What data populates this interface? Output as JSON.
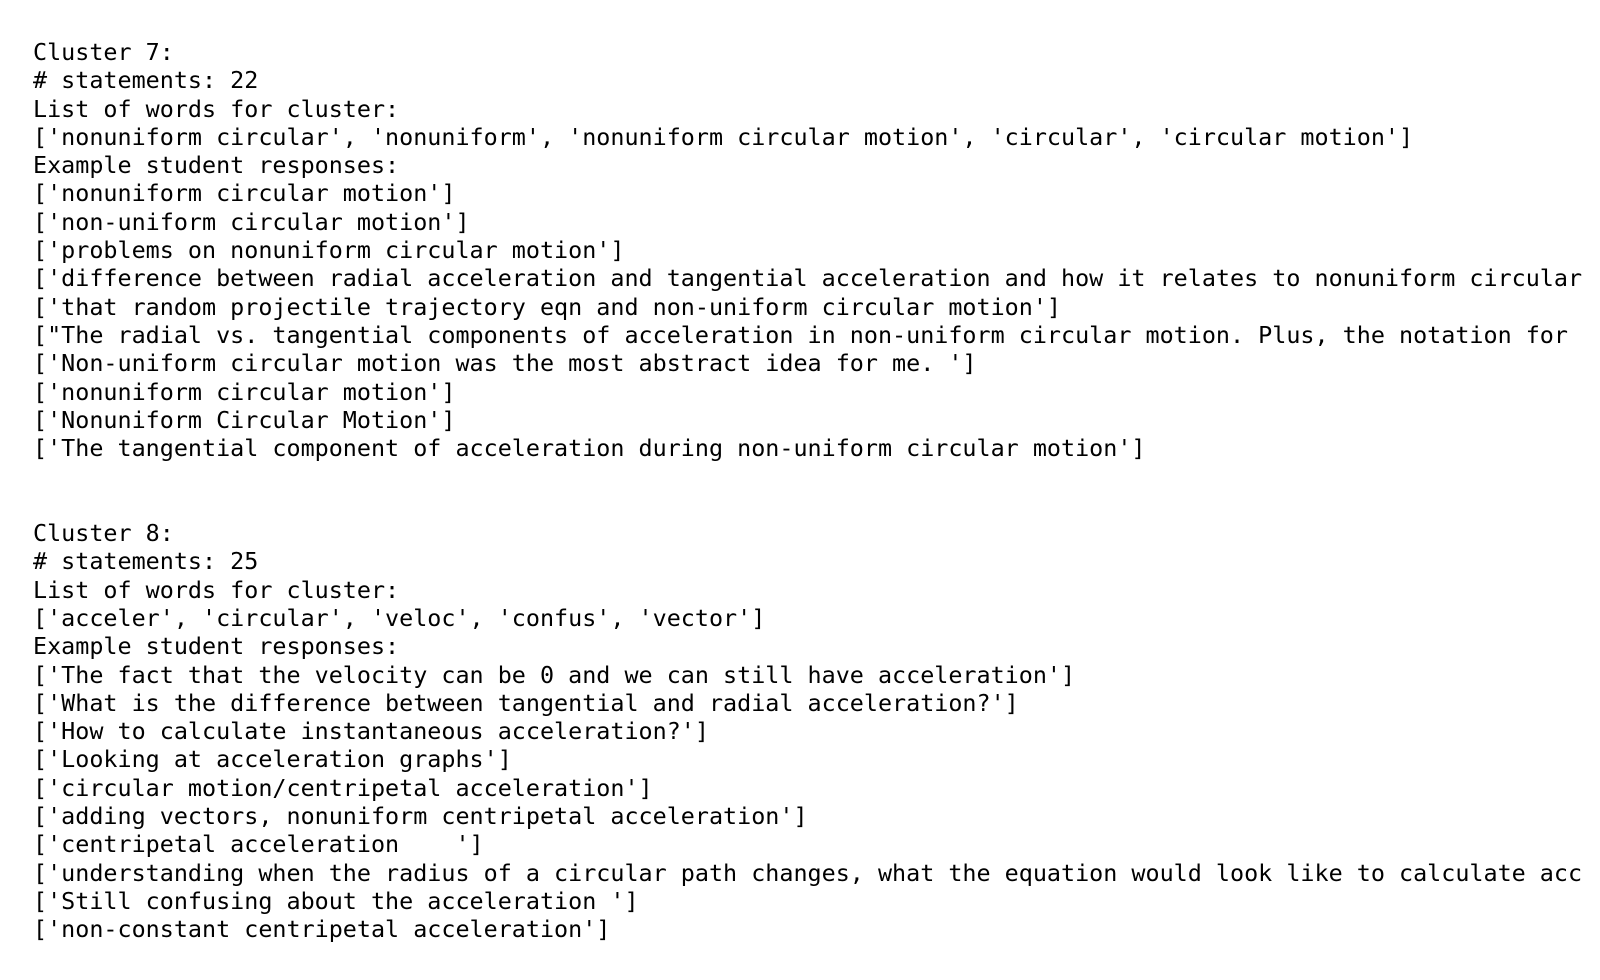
{
  "clusters": [
    {
      "header": "Cluster 7:",
      "statements": "# statements: 22",
      "words_label": "List of words for cluster:",
      "words": "['nonuniform circular', 'nonuniform', 'nonuniform circular motion', 'circular', 'circular motion']",
      "examples_label": "Example student responses:",
      "examples": [
        "['nonuniform circular motion']",
        "['non-uniform circular motion']",
        "['problems on nonuniform circular motion']",
        "['difference between radial acceleration and tangential acceleration and how it relates to nonuniform circular",
        "['that random projectile trajectory eqn and non-uniform circular motion']",
        "[\"The radial vs. tangential components of acceleration in non-uniform circular motion. Plus, the notation for",
        "['Non-uniform circular motion was the most abstract idea for me. ']",
        "['nonuniform circular motion']",
        "['Nonuniform Circular Motion']",
        "['The tangential component of acceleration during non-uniform circular motion']"
      ]
    },
    {
      "header": "Cluster 8:",
      "statements": "# statements: 25",
      "words_label": "List of words for cluster:",
      "words": "['acceler', 'circular', 'veloc', 'confus', 'vector']",
      "examples_label": "Example student responses:",
      "examples": [
        "['The fact that the velocity can be 0 and we can still have acceleration']",
        "['What is the difference between tangential and radial acceleration?']",
        "['How to calculate instantaneous acceleration?']",
        "['Looking at acceleration graphs']",
        "['circular motion/centripetal acceleration']",
        "['adding vectors, nonuniform centripetal acceleration']",
        "['centripetal acceleration    ']",
        "['understanding when the radius of a circular path changes, what the equation would look like to calculate acc",
        "['Still confusing about the acceleration ']",
        "['non-constant centripetal acceleration']"
      ]
    }
  ]
}
